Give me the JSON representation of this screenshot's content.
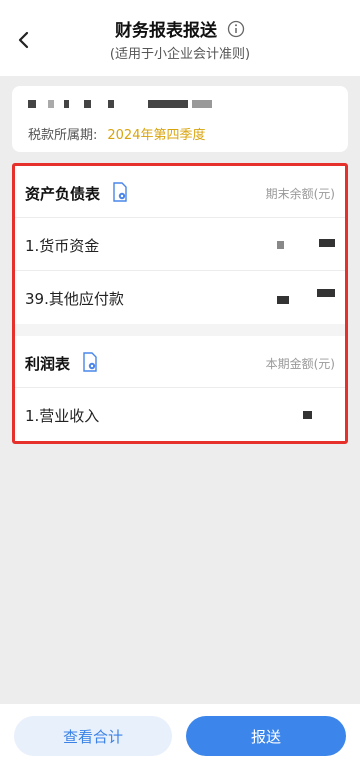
{
  "header": {
    "title": "财务报表报送",
    "subtitle": "(适用于小企业会计准则)",
    "info_icon": "info-icon",
    "back_icon": "chevron-left-icon"
  },
  "summary": {
    "period_label": "税款所属期:",
    "period_value": "2024年第四季度"
  },
  "balance_sheet": {
    "title": "资产负债表",
    "column_label": "期末余额(元)",
    "rows": [
      {
        "label": "1.货币资金"
      },
      {
        "label": "39.其他应付款"
      }
    ]
  },
  "income_statement": {
    "title": "利润表",
    "column_label": "本期金额(元)",
    "rows": [
      {
        "label": "1.营业收入"
      }
    ]
  },
  "footer": {
    "view_total_label": "查看合计",
    "submit_label": "报送"
  },
  "colors": {
    "accent": "#3c85ea",
    "period_highlight": "#d9a40e",
    "highlight_border": "#e6302b"
  }
}
